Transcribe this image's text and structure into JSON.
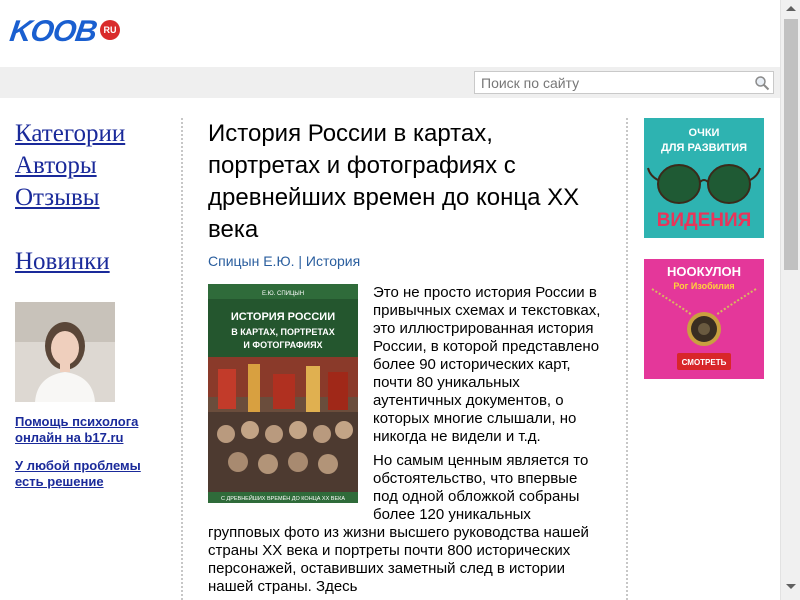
{
  "header": {
    "logo_text": "KOOB",
    "logo_badge": "RU"
  },
  "search": {
    "placeholder": "Поиск по сайту"
  },
  "sidebar": {
    "nav": [
      {
        "label": "Категории"
      },
      {
        "label": "Авторы"
      },
      {
        "label": "Отзывы"
      }
    ],
    "new_label": "Новинки",
    "promo_links": [
      {
        "label": "Помощь психолога онлайн на b17.ru"
      },
      {
        "label": "У любой проблемы есть решение"
      }
    ]
  },
  "book": {
    "title": "История России в картах, портретах и фотографиях с древнейших времен до конца XX века",
    "author": "Спицын Е.Ю.",
    "separator": "|",
    "category": "История",
    "cover": {
      "author": "Е.Ю. СПИЦЫН",
      "title": "ИСТОРИЯ РОССИИ В КАРТАХ, ПОРТРЕТАХ И ФОТОГРАФИЯХ",
      "subtitle": "С ДРЕВНЕЙШИХ ВРЕМЁН ДО КОНЦА XX ВЕКА"
    },
    "paragraphs": [
      "Это не просто история России в привычных схемах и текстовках, это иллюстрированная история России, в которой представлено более 90 исторических карт, почти 80 уникальных аутентичных документов, о которых многие слышали, но никогда не видели и т.д.",
      "Но самым ценным является то обстоятельство, что впервые под одной обложкой собраны более 120 уникальных групповых фото из жизни высшего руководства нашей страны XX века и портреты почти 800 исторических персонажей, оставивших заметный след в истории нашей страны. Здесь"
    ]
  },
  "ads": [
    {
      "line1": "ОЧКИ",
      "line2": "ДЛЯ РАЗВИТИЯ",
      "line3": "ВИДЕНИЯ"
    },
    {
      "line1": "НООКУЛОН",
      "line2": "Рог Изобилия",
      "button": "СМОТРЕТЬ"
    }
  ]
}
